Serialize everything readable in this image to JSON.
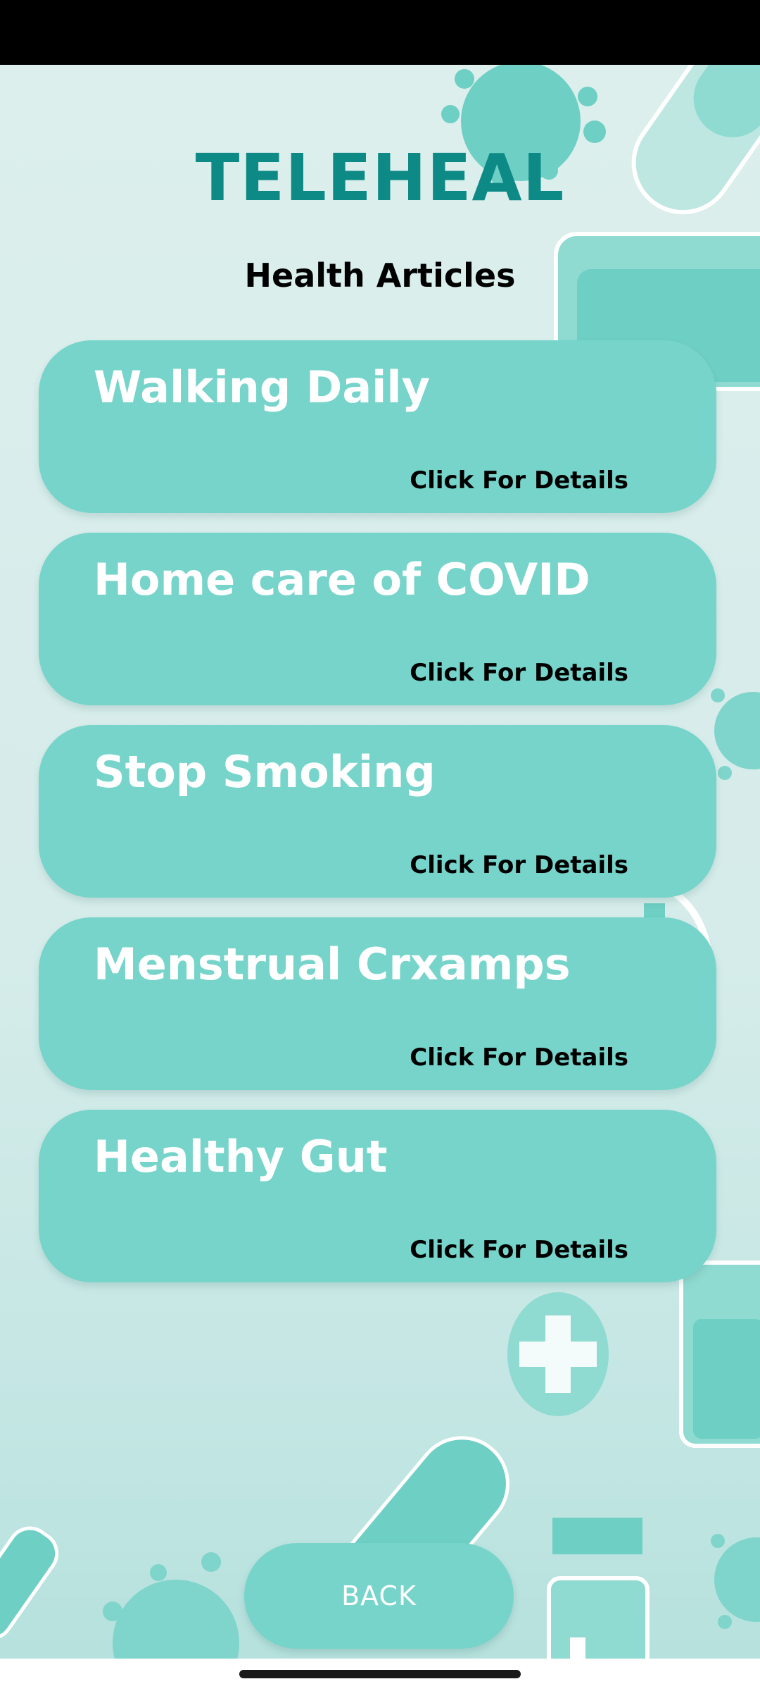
{
  "app": {
    "title": "TELEHEAL",
    "section_title": "Health Articles"
  },
  "articles": [
    {
      "title": "Walking Daily",
      "cta": "Click For Details"
    },
    {
      "title": "Home care of COVID",
      "cta": "Click For Details"
    },
    {
      "title": "Stop Smoking",
      "cta": "Click For Details"
    },
    {
      "title": "Menstrual Crxamps",
      "cta": "Click For Details"
    },
    {
      "title": "Healthy Gut",
      "cta": "Click For Details"
    }
  ],
  "footer": {
    "back_label": "BACK"
  },
  "colors": {
    "accent_teal": "#76d4ca",
    "title_teal": "#0e8a86",
    "background": "#dcefed"
  }
}
